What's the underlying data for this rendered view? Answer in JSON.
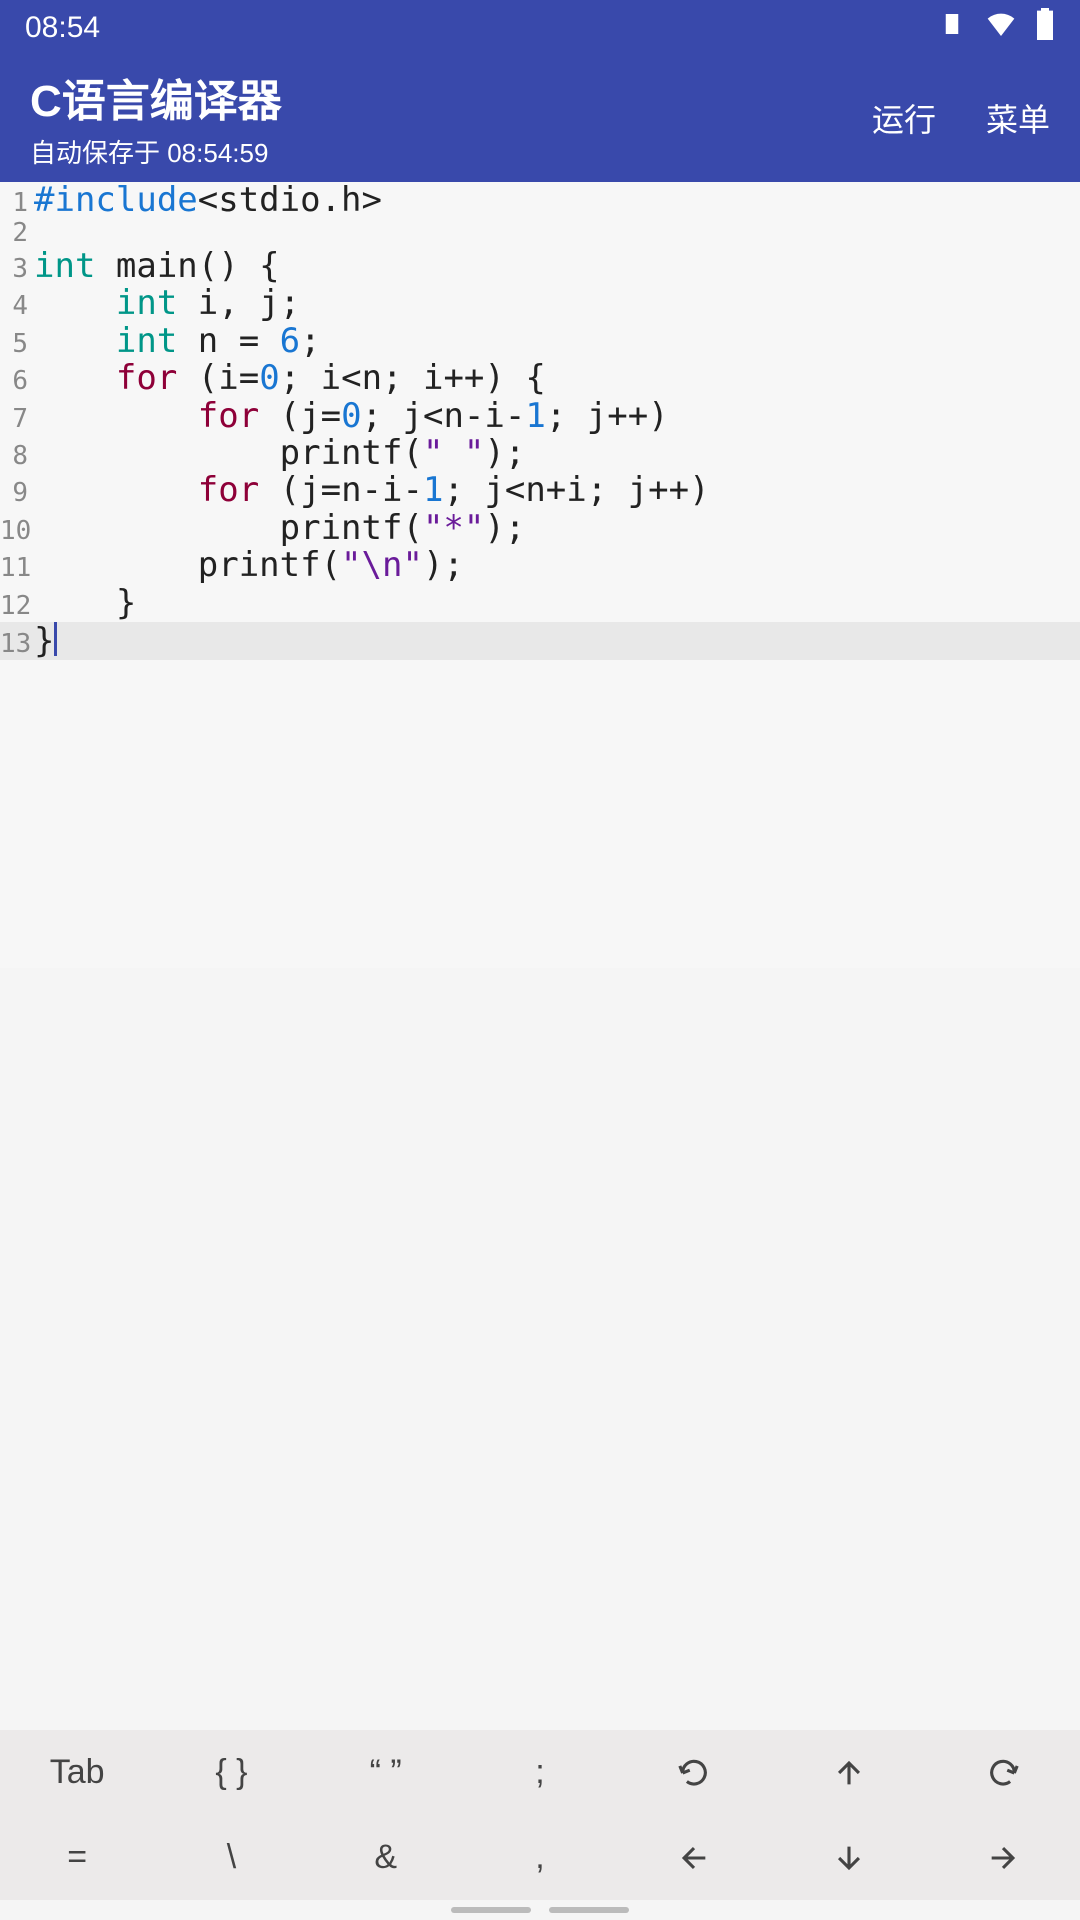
{
  "status": {
    "time": "08:54"
  },
  "header": {
    "title": "C语言编译器",
    "autosave": "自动保存于 08:54:59",
    "run": "运行",
    "menu": "菜单"
  },
  "code": {
    "lines": [
      {
        "n": "1",
        "tokens": [
          [
            "preproc",
            "#include"
          ],
          [
            "plain",
            "<stdio.h>"
          ]
        ]
      },
      {
        "n": "2",
        "tokens": []
      },
      {
        "n": "3",
        "tokens": [
          [
            "type",
            "int"
          ],
          [
            "plain",
            " main() {"
          ]
        ]
      },
      {
        "n": "4",
        "tokens": [
          [
            "plain",
            "    "
          ],
          [
            "type",
            "int"
          ],
          [
            "plain",
            " i, j;"
          ]
        ]
      },
      {
        "n": "5",
        "tokens": [
          [
            "plain",
            "    "
          ],
          [
            "type",
            "int"
          ],
          [
            "plain",
            " n = "
          ],
          [
            "num",
            "6"
          ],
          [
            "plain",
            ";"
          ]
        ]
      },
      {
        "n": "6",
        "tokens": [
          [
            "plain",
            "    "
          ],
          [
            "ctrl",
            "for"
          ],
          [
            "plain",
            " (i="
          ],
          [
            "num",
            "0"
          ],
          [
            "plain",
            "; i<n; i++) {"
          ]
        ]
      },
      {
        "n": "7",
        "tokens": [
          [
            "plain",
            "        "
          ],
          [
            "ctrl",
            "for"
          ],
          [
            "plain",
            " (j="
          ],
          [
            "num",
            "0"
          ],
          [
            "plain",
            "; j<n-i-"
          ],
          [
            "num",
            "1"
          ],
          [
            "plain",
            "; j++)"
          ]
        ]
      },
      {
        "n": "8",
        "tokens": [
          [
            "plain",
            "            printf("
          ],
          [
            "str",
            "\" \""
          ],
          [
            "plain",
            ");"
          ]
        ]
      },
      {
        "n": "9",
        "tokens": [
          [
            "plain",
            "        "
          ],
          [
            "ctrl",
            "for"
          ],
          [
            "plain",
            " (j=n-i-"
          ],
          [
            "num",
            "1"
          ],
          [
            "plain",
            "; j<n+i; j++)"
          ]
        ]
      },
      {
        "n": "10",
        "tokens": [
          [
            "plain",
            "            printf("
          ],
          [
            "str",
            "\"*\""
          ],
          [
            "plain",
            ");"
          ]
        ]
      },
      {
        "n": "11",
        "tokens": [
          [
            "plain",
            "        printf("
          ],
          [
            "str",
            "\"\\n\""
          ],
          [
            "plain",
            ");"
          ]
        ]
      },
      {
        "n": "12",
        "tokens": [
          [
            "plain",
            "    }"
          ]
        ]
      },
      {
        "n": "13",
        "tokens": [
          [
            "plain",
            "}"
          ]
        ],
        "current": true,
        "caret": true
      }
    ]
  },
  "toolbar": {
    "row1": [
      "Tab",
      "{ }",
      "“ ”",
      ";",
      "undo-icon",
      "arrow-up-icon",
      "redo-icon"
    ],
    "row2": [
      "=",
      "\\",
      "&",
      ",",
      "arrow-left-icon",
      "arrow-down-icon",
      "arrow-right-icon"
    ]
  }
}
